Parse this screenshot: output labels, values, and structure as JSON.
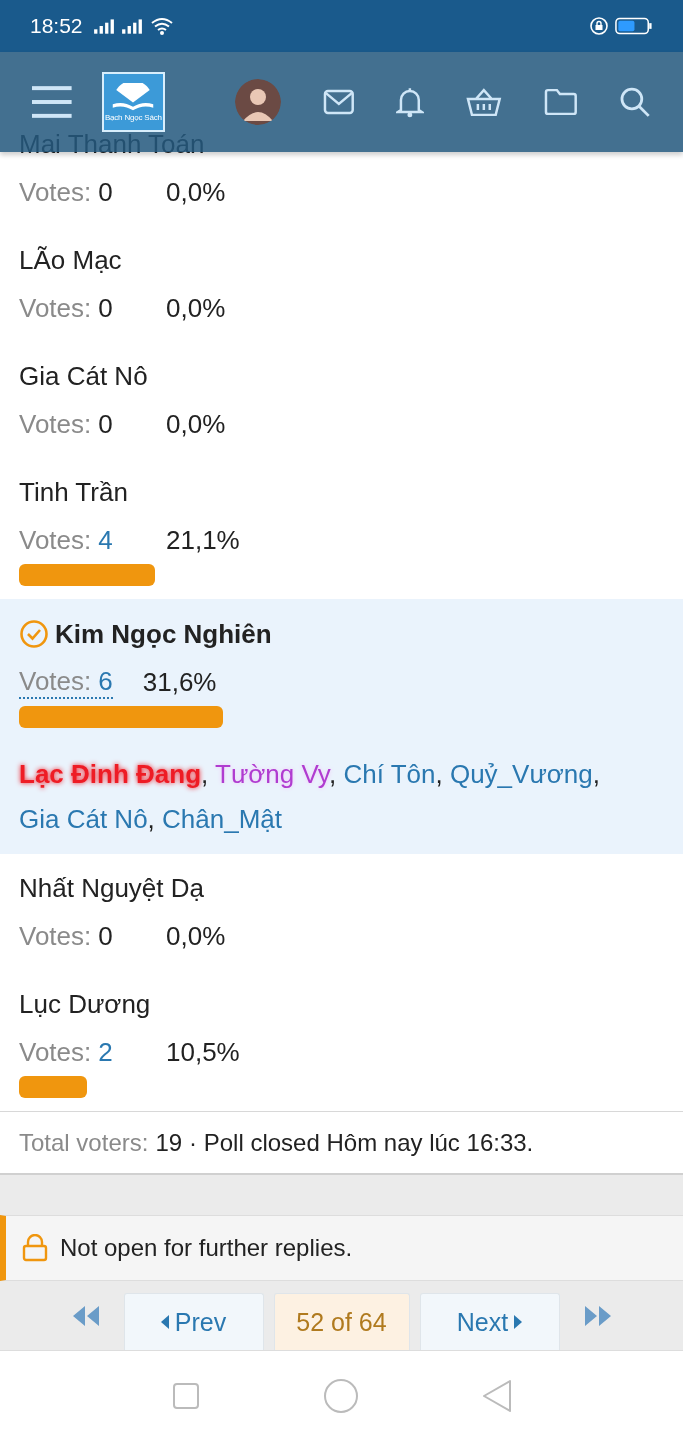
{
  "status_bar": {
    "time": "18:52"
  },
  "header": {
    "logo_text": "Bạch Ngọc Sách"
  },
  "options": [
    {
      "name": "Mai Thanh Toán",
      "votes_label": "Votes:",
      "votes": "0",
      "percent": "0,0%",
      "linked": false,
      "selected": false
    },
    {
      "name": "LÃo Mạc",
      "votes_label": "Votes:",
      "votes": "0",
      "percent": "0,0%",
      "linked": false,
      "selected": false
    },
    {
      "name": "Gia Cát Nô",
      "votes_label": "Votes:",
      "votes": "0",
      "percent": "0,0%",
      "linked": false,
      "selected": false
    },
    {
      "name": "Tinh Trần",
      "votes_label": "Votes:",
      "votes": "4",
      "percent": "21,1%",
      "linked": true,
      "selected": false
    },
    {
      "name": "Kim Ngọc Nghiên",
      "votes_label": "Votes:",
      "votes": "6",
      "percent": "31,6%",
      "linked": true,
      "selected": true,
      "separator": ",",
      "voters": [
        {
          "name": "Lạc Đinh Đang",
          "kind": "bold_glow",
          "color": "#ee1c25"
        },
        {
          "name": "Tường Vy",
          "kind": "glow",
          "color": "#b03cd0"
        },
        {
          "name": "Chí Tôn",
          "kind": "plain",
          "color": "#2a78b0"
        },
        {
          "name": "Quỷ_Vương",
          "kind": "plain",
          "color": "#2a78b0"
        },
        {
          "name": "Gia Cát Nô",
          "kind": "plain",
          "color": "#2a78b0"
        },
        {
          "name": "Chân_Mật",
          "kind": "plain",
          "color": "#2a78b0"
        }
      ]
    },
    {
      "name": "Nhất Nguyệt Dạ",
      "votes_label": "Votes:",
      "votes": "0",
      "percent": "0,0%",
      "linked": false,
      "selected": false
    },
    {
      "name": "Lục Dương",
      "votes_label": "Votes:",
      "votes": "2",
      "percent": "10,5%",
      "linked": true,
      "selected": false
    }
  ],
  "poll_footer": {
    "total_label": "Total voters:",
    "total": "19",
    "closed": "· Poll closed Hôm nay lúc 16:33."
  },
  "notice": "Not open for further replies.",
  "pagination": {
    "prev": "Prev",
    "current": "52 of 64",
    "next": "Next"
  }
}
